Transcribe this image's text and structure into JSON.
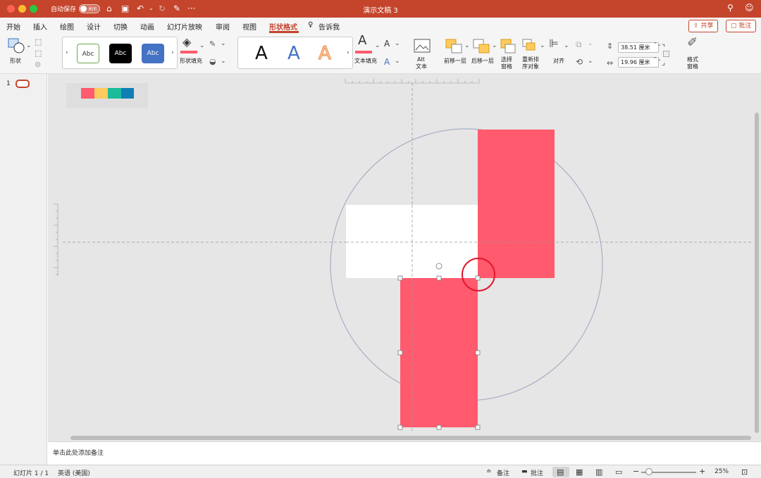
{
  "window": {
    "title": "演示文稿 3",
    "autosave_label": "自动保存",
    "autosave_toggle": "关闭"
  },
  "tabs": [
    "开始",
    "插入",
    "绘图",
    "设计",
    "切换",
    "动画",
    "幻灯片放映",
    "审阅",
    "视图",
    "形状格式"
  ],
  "active_tab": "形状格式",
  "tell_me": "告诉我",
  "share_label": "共享",
  "comment_label": "批注",
  "ribbon": {
    "shape_label": "形状",
    "style_gallery": [
      "Abc",
      "Abc",
      "Abc"
    ],
    "shape_fill_label": "形状填充",
    "text_fill_label": "文本填充",
    "wordart_letters": [
      "A",
      "A",
      "A"
    ],
    "alt_text_label_1": "Alt",
    "alt_text_label_2": "文本",
    "bring_forward_label": "前移一层",
    "send_backward_label": "后移一层",
    "selection_pane_label_1": "选择",
    "selection_pane_label_2": "窗格",
    "reorder_label_1": "重新排",
    "reorder_label_2": "序对象",
    "align_label": "对齐",
    "height_value": "38.51 厘米",
    "width_value": "19.96 厘米",
    "format_pane_label_1": "格式",
    "format_pane_label_2": "窗格"
  },
  "thumbnail": {
    "slide_number": "1"
  },
  "notes_placeholder": "单击此处添加备注",
  "status": {
    "slide_info": "幻灯片 1 / 1",
    "language": "英语 (美国)",
    "notes_label": "备注",
    "comments_label": "批注",
    "zoom": "25%"
  },
  "colors": {
    "accent": "#c4452c",
    "shape_red": "#ff5a6e",
    "palette": [
      "#ff5a6e",
      "#ffcb5c",
      "#1abc9c",
      "#0e7fb5"
    ]
  }
}
